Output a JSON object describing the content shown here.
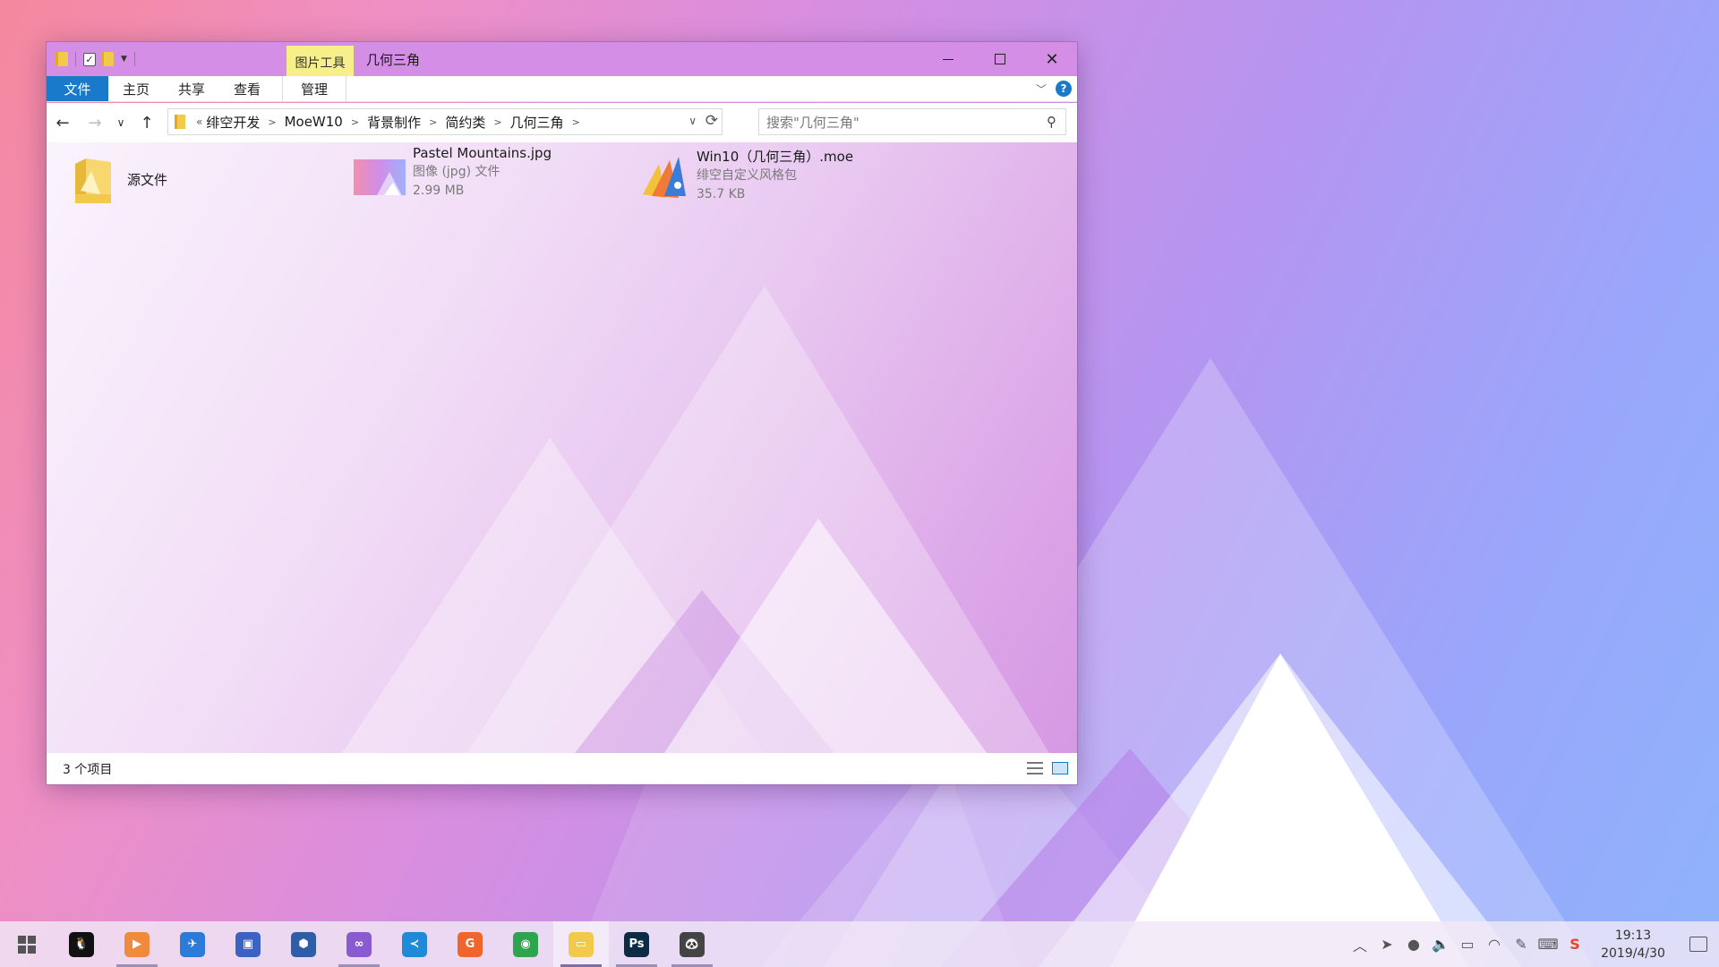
{
  "window": {
    "title": "几何三角",
    "context_tab": "图片工具",
    "ribbon_tabs": [
      "文件",
      "主页",
      "共享",
      "查看",
      "管理"
    ],
    "help_label": "?"
  },
  "address": {
    "overflow_marker": "«",
    "crumbs": [
      "绯空开发",
      "MoeW10",
      "背景制作",
      "简约类",
      "几何三角"
    ]
  },
  "search": {
    "placeholder": "搜索\"几何三角\""
  },
  "items": [
    {
      "name": "源文件",
      "type": "",
      "size": "",
      "icon": "folder-icon"
    },
    {
      "name": "Pastel Mountains.jpg",
      "type": "图像 (jpg) 文件",
      "size": "2.99 MB",
      "icon": "image-thumbnail-icon"
    },
    {
      "name": "Win10（几何三角）.moe",
      "type": "绯空自定义风格包",
      "size": "35.7 KB",
      "icon": "moe-package-icon"
    }
  ],
  "status": {
    "item_count": "3 个项目"
  },
  "taskbar": {
    "apps": [
      {
        "name": "qq-icon",
        "color": "#111111"
      },
      {
        "name": "media-player-icon",
        "color": "#f08a3c"
      },
      {
        "name": "bird-app-icon",
        "color": "#2d7bd8"
      },
      {
        "name": "remote-desktop-icon",
        "color": "#3b63c4"
      },
      {
        "name": "virtualbox-icon",
        "color": "#2f5ea8"
      },
      {
        "name": "visual-studio-icon",
        "color": "#8a5bd0"
      },
      {
        "name": "vscode-icon",
        "color": "#1f8ad8"
      },
      {
        "name": "grammarly-icon",
        "color": "#f2652a"
      },
      {
        "name": "chrome-icon",
        "color": "#2ea44f"
      },
      {
        "name": "file-explorer-icon",
        "color": "#f2c94a"
      },
      {
        "name": "photoshop-icon",
        "color": "#0c2b45"
      },
      {
        "name": "panda-app-icon",
        "color": "#444444"
      }
    ],
    "tray_icons": [
      "chevron-up-icon",
      "send-icon",
      "qq-tray-icon",
      "volume-icon",
      "battery-icon",
      "wifi-icon",
      "pen-icon",
      "keyboard-icon",
      "sogou-icon"
    ],
    "time": "19:13",
    "date": "2019/4/30"
  },
  "colors": {
    "accent": "#1979ca",
    "titlebar": "#d48ee6",
    "context_tab": "#f7ef8a"
  }
}
